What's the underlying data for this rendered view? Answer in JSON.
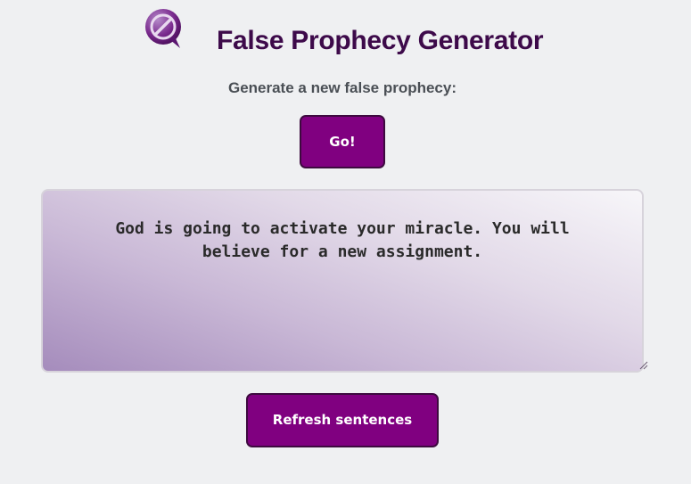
{
  "header": {
    "title": "False Prophecy Generator",
    "logo_icon": "speech-bubble-slash-icon"
  },
  "main": {
    "prompt": "Generate a new false prophecy:",
    "go_button_label": "Go!",
    "prophecy_text": "God is going to activate your miracle. You will believe for a new assignment.",
    "refresh_button_label": "Refresh sentences"
  },
  "colors": {
    "accent": "#800080",
    "title": "#3d0a4a",
    "background": "#eff0f2"
  }
}
